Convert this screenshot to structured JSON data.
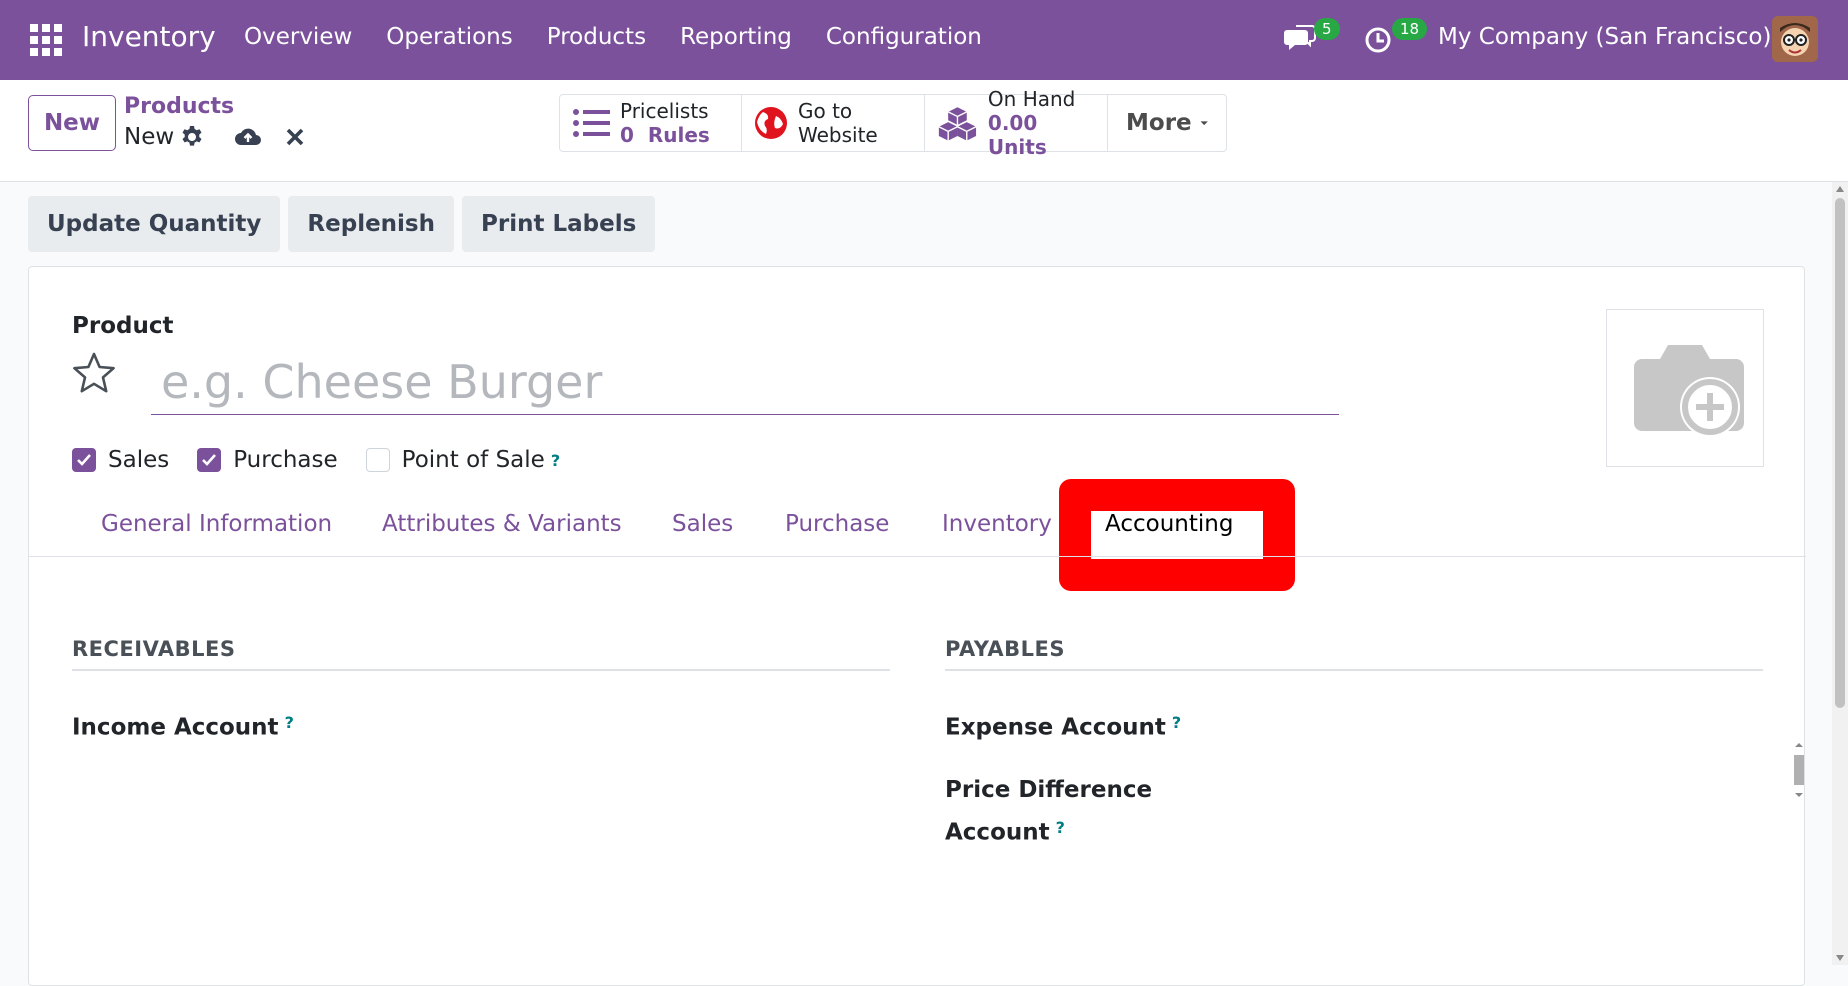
{
  "topbar": {
    "brand": "Inventory",
    "nav": [
      "Overview",
      "Operations",
      "Products",
      "Reporting",
      "Configuration"
    ],
    "chat_count": "5",
    "activity_count": "18",
    "company": "My Company (San Francisco)",
    "color": "#7c519b"
  },
  "control": {
    "new_label": "New",
    "breadcrumb_parent": "Products",
    "breadcrumb_current": "New"
  },
  "smart_buttons": {
    "pricelists_l1": "Pricelists",
    "pricelists_l2": "0  Rules",
    "website_l1": "Go to",
    "website_l2": "Website",
    "onhand_l1": "On Hand",
    "onhand_l2": "0.00 Units",
    "more": "More"
  },
  "actions": {
    "update_quantity": "Update Quantity",
    "replenish": "Replenish",
    "print_labels": "Print Labels"
  },
  "form": {
    "product_label": "Product",
    "name_placeholder": "e.g. Cheese Burger",
    "sales_label": "Sales",
    "purchase_label": "Purchase",
    "pos_label": "Point of Sale",
    "tip": "?"
  },
  "tabs": {
    "general": "General Information",
    "attributes": "Attributes & Variants",
    "sales": "Sales",
    "purchase": "Purchase",
    "inventory": "Inventory",
    "accounting": "Accounting"
  },
  "accounting": {
    "receivables_title": "RECEIVABLES",
    "income_account": "Income Account",
    "payables_title": "PAYABLES",
    "expense_account": "Expense Account",
    "price_diff_l1": "Price Difference",
    "price_diff_l2": "Account"
  },
  "highlight_color": "#ff0000"
}
